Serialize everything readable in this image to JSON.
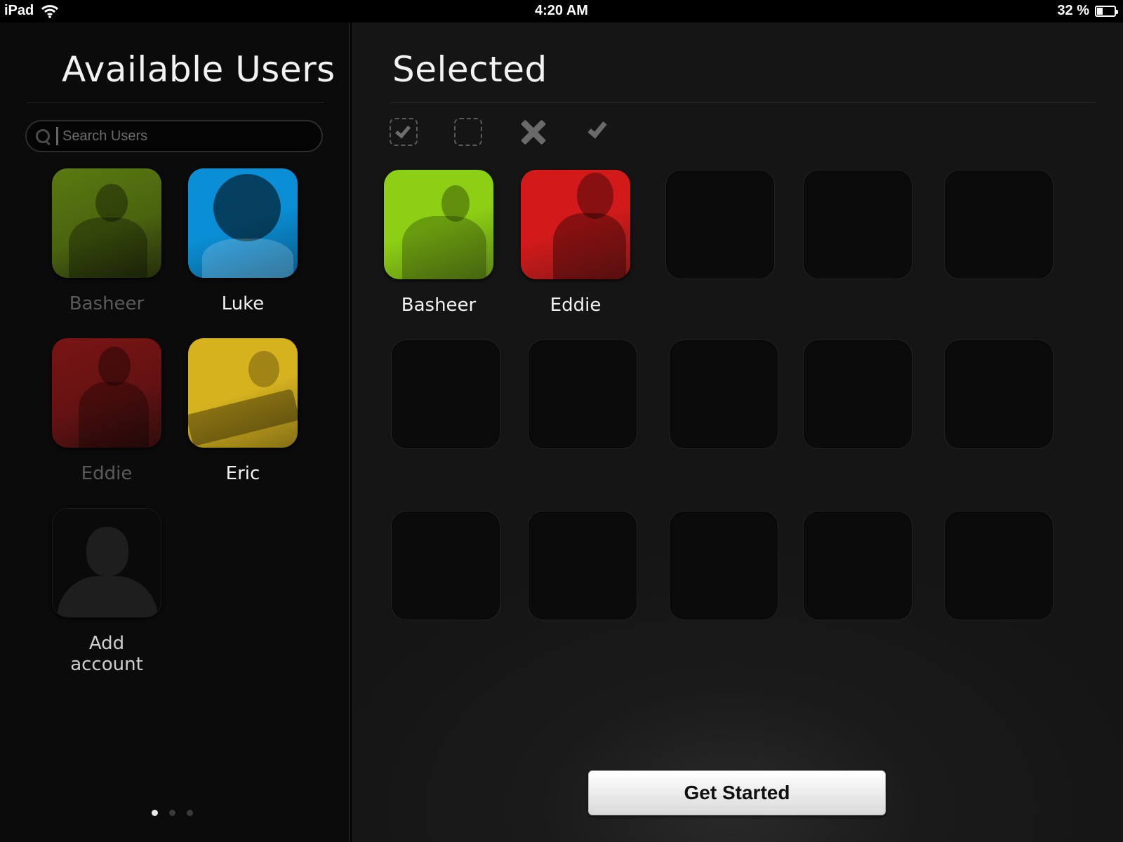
{
  "status_bar": {
    "device": "iPad",
    "time": "4:20 AM",
    "battery_percent": "32 %",
    "battery_level": 0.32
  },
  "left_panel": {
    "title": "Available Users",
    "search": {
      "placeholder": "Search Users",
      "value": ""
    },
    "users": [
      {
        "name": "Basheer",
        "color": "#5a7a10",
        "state": "dim"
      },
      {
        "name": "Luke",
        "color": "#0a8fd6",
        "state": "bright"
      },
      {
        "name": "Eddie",
        "color": "#7a1414",
        "state": "dim"
      },
      {
        "name": "Eric",
        "color": "#d6b21e",
        "state": "bright"
      }
    ],
    "add_account_label": "Add account",
    "page_count": 3,
    "current_page": 1
  },
  "right_panel": {
    "title": "Selected",
    "toolbar": [
      "select-all-icon",
      "deselect-all-icon",
      "remove-icon",
      "confirm-icon"
    ],
    "selected_users": [
      {
        "name": "Basheer",
        "color": "#8ccf14"
      },
      {
        "name": "Eddie",
        "color": "#d21a1a"
      }
    ],
    "get_started_label": "Get Started"
  }
}
